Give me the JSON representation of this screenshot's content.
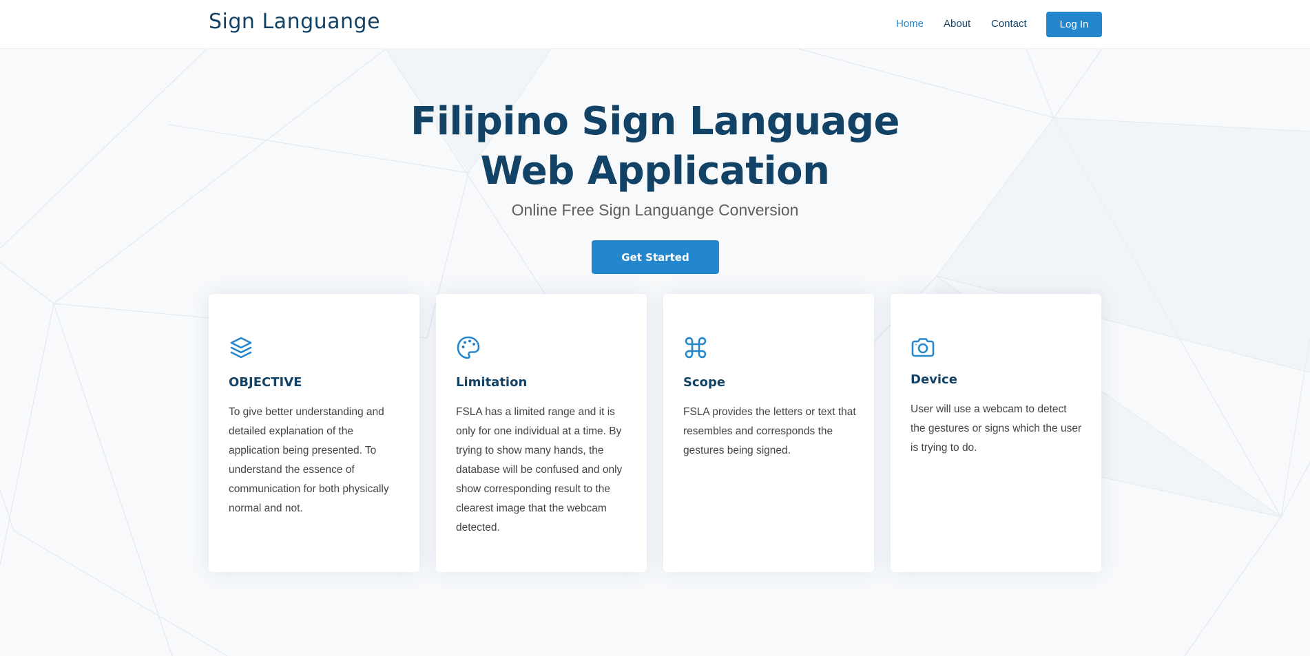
{
  "header": {
    "logo": "Sign Languange",
    "nav": [
      {
        "label": "Home",
        "active": true
      },
      {
        "label": "About",
        "active": false
      },
      {
        "label": "Contact",
        "active": false
      }
    ],
    "login_label": "Log In"
  },
  "hero": {
    "title_line1": "Filipino Sign Language",
    "title_line2": "Web Application",
    "subtitle": "Online Free Sign Languange Conversion",
    "cta_label": "Get Started"
  },
  "cards": [
    {
      "icon": "layers-icon",
      "title": "OBJECTIVE",
      "description": "To give better understanding and detailed explanation of the application being presented. To understand the essence of communication for both physically normal and not."
    },
    {
      "icon": "palette-icon",
      "title": "Limitation",
      "description": "FSLA has a limited range and it is only for one individual at a time. By trying to show many hands, the database will be confused and only show corresponding result to the clearest image that the webcam detected."
    },
    {
      "icon": "command-icon",
      "title": "Scope",
      "description": "FSLA provides the letters or text that resembles and corresponds the gestures being signed."
    },
    {
      "icon": "camera-icon",
      "title": "Device",
      "description": "User will use a webcam to detect the gestures or signs which the user is trying to do."
    }
  ],
  "colors": {
    "brand": "#124265",
    "accent": "#2487ce",
    "hero_bg": "#f7f9fb"
  }
}
